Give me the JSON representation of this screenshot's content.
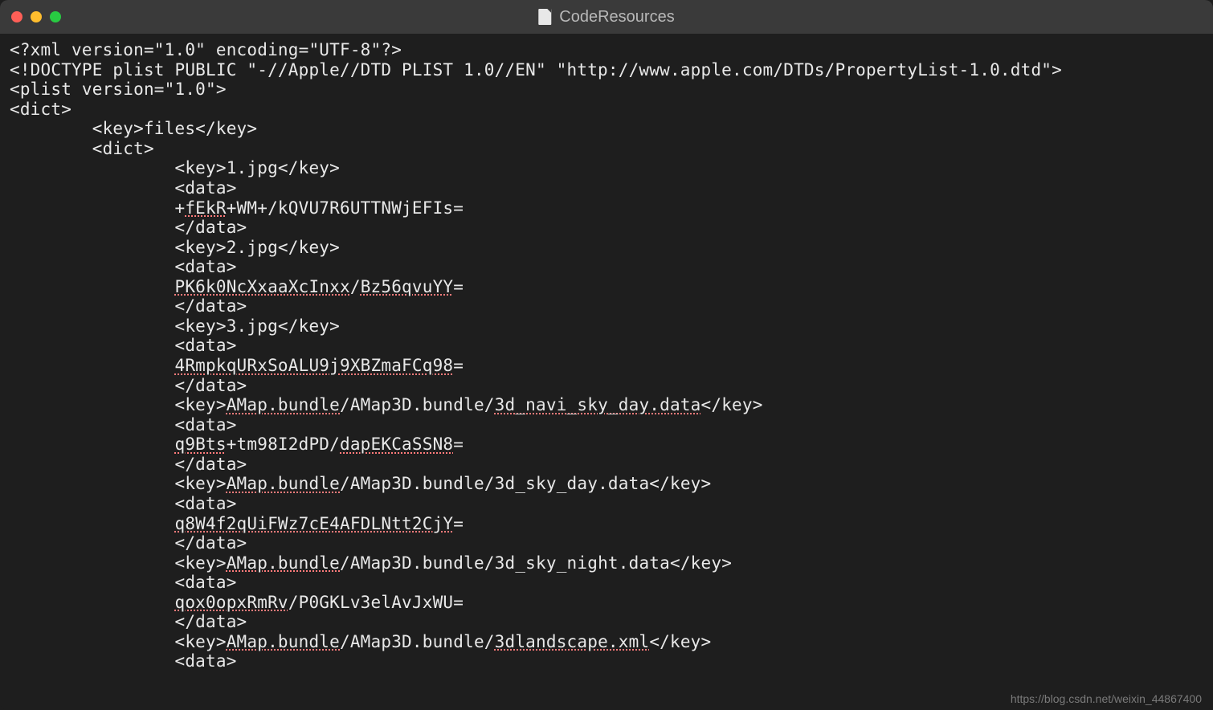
{
  "window": {
    "title": "CodeResources"
  },
  "code": {
    "line01": "<?xml version=\"1.0\" encoding=\"UTF-8\"?>",
    "line02": "<!DOCTYPE plist PUBLIC \"-//Apple//DTD PLIST 1.0//EN\" \"http://www.apple.com/DTDs/PropertyList-1.0.dtd\">",
    "line03": "<plist version=\"1.0\">",
    "line04": "<dict>",
    "line05": "        <key>files</key>",
    "line06": "        <dict>",
    "line07": "                <key>1.jpg</key>",
    "line08": "                <data>",
    "line09a": "                +",
    "line09b": "fEkR",
    "line09c": "+WM+/kQVU7R6UTTNWjEFIs=",
    "line10": "                </data>",
    "line11": "                <key>2.jpg</key>",
    "line12": "                <data>",
    "line13a": "                ",
    "line13b": "PK6k0NcXxaaXcInxx",
    "line13c": "/",
    "line13d": "Bz56qvuYY",
    "line13e": "=",
    "line14": "                </data>",
    "line15": "                <key>3.jpg</key>",
    "line16": "                <data>",
    "line17a": "                ",
    "line17b": "4RmpkqURxSoALU9j9XBZmaFCq98",
    "line17c": "=",
    "line18": "                </data>",
    "line19a": "                <key>",
    "line19b": "AMap.bundle",
    "line19c": "/AMap3D.bundle/",
    "line19d": "3d_navi_sky_day.data",
    "line19e": "</key>",
    "line20": "                <data>",
    "line21a": "                ",
    "line21b": "q9Bts",
    "line21c": "+tm98I2dPD/",
    "line21d": "dapEKCaSSN8",
    "line21e": "=",
    "line22": "                </data>",
    "line23a": "                <key>",
    "line23b": "AMap.bundle",
    "line23c": "/AMap3D.bundle/3d_sky_day.data</key>",
    "line24": "                <data>",
    "line25a": "                ",
    "line25b": "q8W4f2qUiFWz7cE4AFDLNtt2CjY",
    "line25c": "=",
    "line26": "                </data>",
    "line27a": "                <key>",
    "line27b": "AMap.bundle",
    "line27c": "/AMap3D.bundle/3d_sky_night.data</key>",
    "line28": "                <data>",
    "line29a": "                ",
    "line29b": "qox0opxRmRv",
    "line29c": "/P0GKLv3elAvJxWU=",
    "line30": "                </data>",
    "line31a": "                <key>",
    "line31b": "AMap.bundle",
    "line31c": "/AMap3D.bundle/",
    "line31d": "3dlandscape.xml",
    "line31e": "</key>",
    "line32": "                <data>"
  },
  "watermark": "https://blog.csdn.net/weixin_44867400"
}
